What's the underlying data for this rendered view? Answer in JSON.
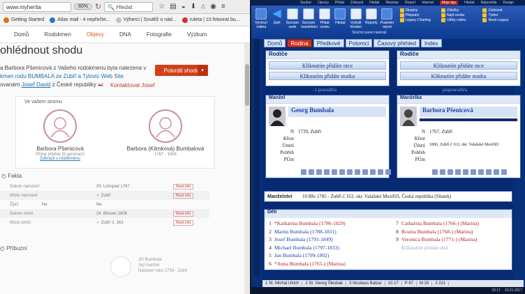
{
  "browser": {
    "url": "www.myherita",
    "zoom": "80%",
    "search_placeholder": "Hledat",
    "bookmarks": [
      "Getting Started",
      "Atlas mail - 4 nepřečte...",
      "Výherci | Soutěž o nád...",
      "ruleta | 10.fotovrat bu..."
    ],
    "nav_tabs": [
      "Domů",
      "Rodokmen",
      "Objevy",
      "DNA",
      "Fotografie",
      "Výzkum"
    ],
    "active_tab": "Objevy"
  },
  "match": {
    "title": "ohlédnout shodu",
    "desc_line1": "a Barbora Pšenicová z Vašeho rodokmenu byla nalezena v",
    "desc_line2": "kmen rodu BUMBALA ze Zubří a Tylovic Web Site",
    "desc_line3_pre": "ovaném",
    "desc_line3_link": "Josef David",
    "desc_line3_post": "z České republiky",
    "confirm_button": "Potvrdit shodu",
    "contact_link": "Kontaktovat Josef",
    "panel_header": "Ve vašem stromu",
    "person_left_name": "Barbora Pšenicová",
    "person_left_sub": "Přímý předek (6 generací)",
    "person_left_link": "Zobrazit v rodokmenu",
    "person_right_name": "Barbora (Klimková) Bumbalová",
    "person_right_sub": "1767 - 1806"
  },
  "facts": {
    "title": "Fakta",
    "rows": [
      {
        "label": "Datum narození",
        "value": "30. Listopad 1767",
        "badge": "Nové info"
      },
      {
        "label": "Místo narození",
        "value": "Zubří",
        "badge": "Nové info"
      },
      {
        "label": "Žijící",
        "left": "Ne",
        "value": "Ne",
        "badge": ""
      },
      {
        "label": "Datum úmrtí",
        "value": "24. Březen 1806",
        "badge": "Nové info"
      },
      {
        "label": "Místo úmrtí",
        "value": "Zubří č. 163",
        "badge": "Nové info"
      }
    ],
    "relatives_title": "Příbuzní",
    "rel_name": "Jiří Bumbala",
    "rel_role": "Její manžel",
    "rel_dates": "Narozen roku 1739 - Zubří"
  },
  "legacy": {
    "menu": [
      "Soubor",
      "Úpravy",
      "Přidat",
      "Zobrazit",
      "Hledat",
      "Nástroje",
      "Report",
      "Internet",
      "Moje tipy",
      "Hledat",
      "Nápověda",
      "Design"
    ],
    "ribbon": [
      {
        "label": "Výchozí rodina"
      },
      {
        "label": "Zpět"
      },
      {
        "label": "Seznam osob"
      },
      {
        "label": "Seznam manželství"
      },
      {
        "label": "Přidat osobu"
      },
      {
        "label": "Hledat"
      },
      {
        "label": "Vyčistit hledání"
      },
      {
        "label": "Reporty"
      },
      {
        "label": "Poslední report"
      }
    ],
    "ribbon_right": [
      "Skupiny",
      "Záložky",
      "Čárkovat",
      "Přepsání",
      "Najít osobu",
      "Týden",
      "Legacy Charting",
      "Útěky rodiny",
      "Nová Legacy"
    ],
    "ribbon_caption": "Stručný panel nástrojů",
    "tabs": [
      "Domů",
      "Rodina",
      "Předkové",
      "Potomci",
      "Časový přehled",
      "Index"
    ],
    "active_tab": "Rodina",
    "parents_label": "Rodiče",
    "add_father": "Kliknutím přidáte otce",
    "add_mother": "Kliknutím přidáte matku",
    "gen_left": "-1 prarodiča",
    "gen_right": "praprarodiča",
    "husband_label": "Manžel",
    "wife_label": "Manželka",
    "husband_name": "Georg Bumbala",
    "wife_name": "Barbora Pšenicová",
    "row_keys": [
      "N",
      "Křest",
      "Úmrtí",
      "Pohřeb",
      "PÚm"
    ],
    "husband_rows": [
      "1739, Zubří",
      "",
      "",
      "",
      ""
    ],
    "wife_rows": [
      "1767, Zubří",
      "",
      "1806, Zubří č 163, okr. Valašské Meziříčí",
      "",
      ""
    ],
    "marriage_label": "Manželství",
    "marriage_text": "10 Bře 1785 - Zubří č.163, okr. Valašské Meziříčí, Česká republika (Sňatek)",
    "children_label": "Děti",
    "children_left": [
      {
        "n": "1",
        "name": "*Katharina Bumbala (1786-1829)",
        "cls": "red"
      },
      {
        "n": "2",
        "name": "Martin Bumbala (1788-1831)",
        "cls": ""
      },
      {
        "n": "3",
        "name": "Josef Bumbala (1791-1849)",
        "cls": ""
      },
      {
        "n": "4",
        "name": "Michael Bumbala (1797-1833)",
        "cls": ""
      },
      {
        "n": "5",
        "name": "Jan Bumbala (1799-1802)",
        "cls": ""
      },
      {
        "n": "6",
        "name": "*Anna Bumbala (1765-) (Marina)",
        "cls": "red"
      }
    ],
    "children_right": [
      {
        "n": "7",
        "name": "Catharina Bumbala (1766-) (Marina)",
        "cls": "red"
      },
      {
        "n": "8",
        "name": "Rosina Bumbala (1768-) (Marina)",
        "cls": "red"
      },
      {
        "n": "9",
        "name": "Veronica Bumbala (1771-) (Marina)",
        "cls": "red"
      },
      {
        "n": "",
        "name": "Kliknutím přidáte dítě",
        "cls": "gray"
      }
    ],
    "status": [
      "1 St. Michal Ulrich",
      "2 St. Georg Šlesbak",
      "3 Nicolaus Balzar",
      "10.17",
      "P 67",
      "M 33",
      "2 221"
    ],
    "clock": "22:17",
    "date": "20.01.2017"
  }
}
